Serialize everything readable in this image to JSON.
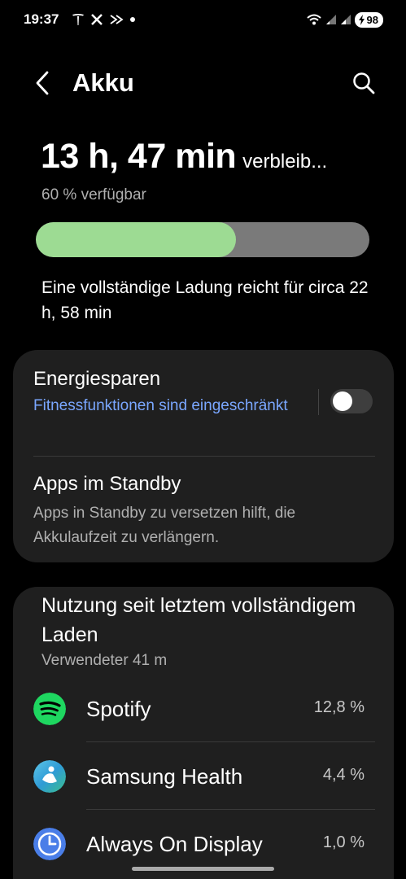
{
  "status_bar": {
    "time": "19:37",
    "battery": "98",
    "icons": [
      "tesla-icon",
      "x-icon",
      "app-icon",
      "dot-icon",
      "wifi-icon",
      "signal-icon",
      "signal-icon",
      "charging-icon"
    ]
  },
  "header": {
    "title": "Akku",
    "back_icon": "chevron-left-icon",
    "search_icon": "search-icon"
  },
  "battery": {
    "remaining_time": "13 h, 47 min",
    "remaining_suffix": "verbleib...",
    "available": "60 % verfügbar",
    "level_percent": 60,
    "full_charge_text": "Eine vollständige Ladung reicht für circa 22 h, 58 min",
    "fill_color": "#9ddb93"
  },
  "settings": {
    "power_saving": {
      "title": "Energiesparen",
      "subtitle": "Fitnessfunktionen sind eingeschränkt",
      "enabled": false
    },
    "standby": {
      "title": "Apps im Standby",
      "subtitle": "Apps in Standby zu versetzen hilft, die Akkulaufzeit zu verlängern."
    }
  },
  "usage": {
    "title": "Nutzung seit letztem vollständigem Laden",
    "subtitle": "Verwendeter 41 m",
    "apps": [
      {
        "name": "Spotify",
        "percent": "12,8 %",
        "icon": "spotify-icon"
      },
      {
        "name": "Samsung Health",
        "percent": "4,4 %",
        "icon": "samsung-health-icon"
      },
      {
        "name": "Always On Display",
        "percent": "1,0 %",
        "icon": "clock-icon"
      }
    ]
  },
  "colors": {
    "accent_blue": "#7aa7ff",
    "spotify_green": "#1ed760"
  }
}
